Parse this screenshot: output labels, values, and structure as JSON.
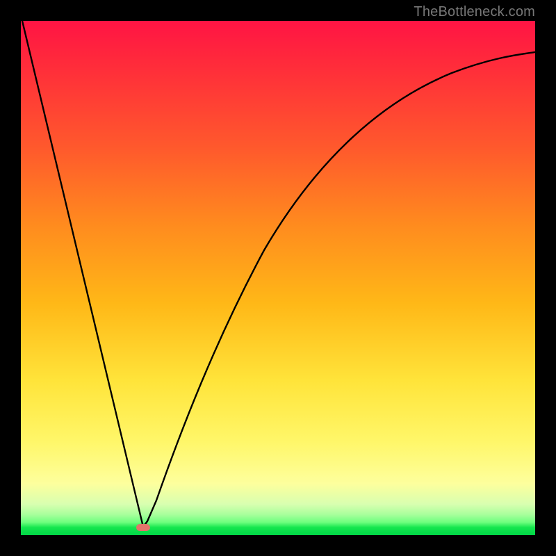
{
  "watermark": "TheBottleneck.com",
  "chart_data": {
    "type": "line",
    "title": "",
    "xlabel": "",
    "ylabel": "",
    "xlim": [
      0,
      100
    ],
    "ylim": [
      0,
      100
    ],
    "x": [
      0,
      5,
      10,
      15,
      20,
      22,
      24,
      26,
      28,
      30,
      35,
      40,
      45,
      50,
      55,
      60,
      65,
      70,
      75,
      80,
      85,
      90,
      95,
      100
    ],
    "values": [
      100,
      78,
      57,
      35,
      13,
      4,
      0,
      4,
      12,
      20,
      36,
      49,
      58,
      65,
      71,
      76,
      80,
      83,
      86,
      88,
      90,
      91,
      92,
      93
    ],
    "minimum": {
      "x": 24,
      "y": 0
    },
    "gradient_axis": "y",
    "gradient_meaning": "color encodes y-value (bottleneck severity): green=low, red=high"
  },
  "marker": {
    "x_fraction": 0.235,
    "y_fraction": 0.985,
    "color": "#e2746a"
  }
}
